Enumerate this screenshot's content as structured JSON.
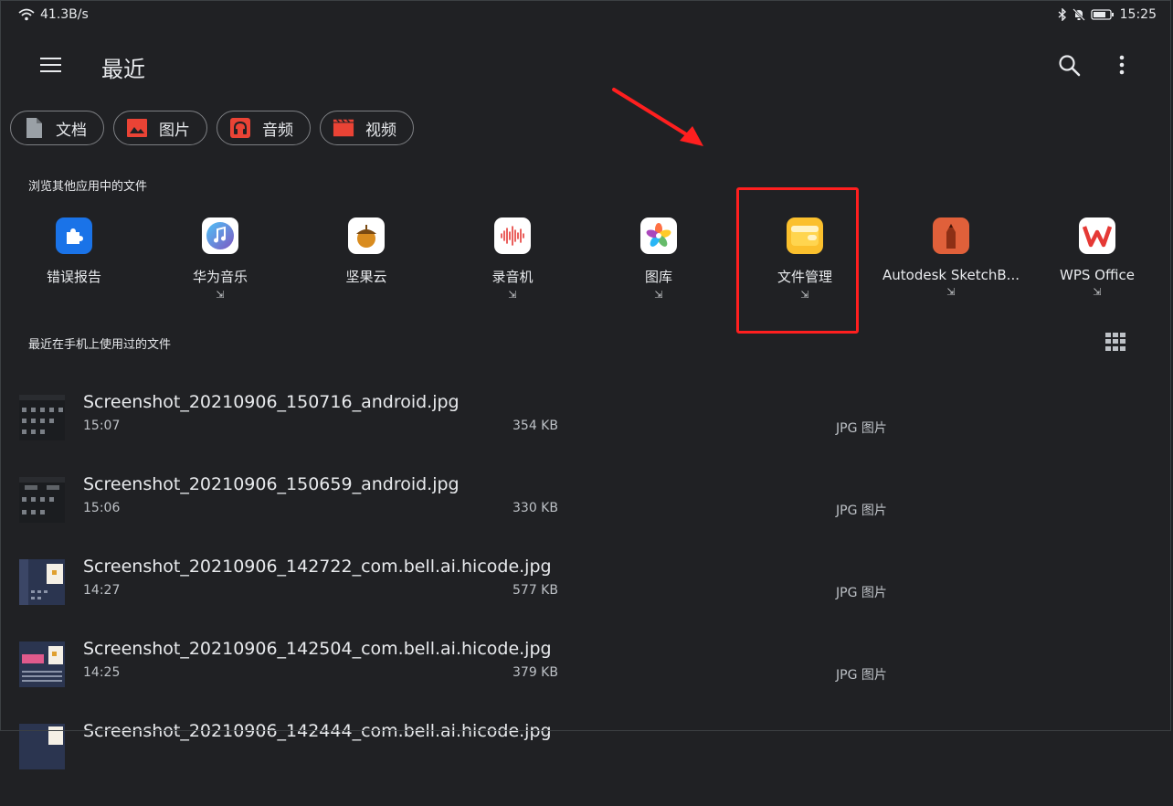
{
  "status_bar": {
    "network_speed": "41.3B/s",
    "time": "15:25"
  },
  "app_bar": {
    "title": "最近"
  },
  "chips": [
    {
      "label": "文档",
      "icon": "document-icon",
      "color": "#9aa0a6"
    },
    {
      "label": "图片",
      "icon": "image-icon",
      "color": "#ea4335"
    },
    {
      "label": "音频",
      "icon": "headphones-icon",
      "color": "#ea4335"
    },
    {
      "label": "视频",
      "icon": "movie-icon",
      "color": "#ea4335"
    }
  ],
  "browse_section": {
    "title": "浏览其他应用中的文件",
    "apps": [
      {
        "label": "错误报告",
        "ext": "",
        "icon": "puzzle-icon"
      },
      {
        "label": "华为音乐",
        "ext": "⇲",
        "icon": "music-icon"
      },
      {
        "label": "坚果云",
        "ext": "",
        "icon": "nut-icon"
      },
      {
        "label": "录音机",
        "ext": "⇲",
        "icon": "waveform-icon"
      },
      {
        "label": "图库",
        "ext": "⇲",
        "icon": "gallery-icon"
      },
      {
        "label": "文件管理",
        "ext": "⇲",
        "icon": "folder-icon"
      },
      {
        "label": "Autodesk SketchB...",
        "ext": "⇲",
        "icon": "pencil-icon"
      },
      {
        "label": "WPS Office",
        "ext": "⇲",
        "icon": "wps-icon"
      }
    ]
  },
  "recent_section": {
    "title": "最近在手机上使用过的文件"
  },
  "files": [
    {
      "name": "Screenshot_20210906_150716_android.jpg",
      "time": "15:07",
      "size": "354 KB",
      "type": "JPG 图片"
    },
    {
      "name": "Screenshot_20210906_150659_android.jpg",
      "time": "15:06",
      "size": "330 KB",
      "type": "JPG 图片"
    },
    {
      "name": "Screenshot_20210906_142722_com.bell.ai.hicode.jpg",
      "time": "14:27",
      "size": "577 KB",
      "type": "JPG 图片"
    },
    {
      "name": "Screenshot_20210906_142504_com.bell.ai.hicode.jpg",
      "time": "14:25",
      "size": "379 KB",
      "type": "JPG 图片"
    },
    {
      "name": "Screenshot_20210906_142444_com.bell.ai.hicode.jpg",
      "time": "",
      "size": "",
      "type": ""
    }
  ],
  "colors": {
    "background": "#202124",
    "annotation": "#ff1f1f",
    "accent_red": "#ea4335"
  }
}
